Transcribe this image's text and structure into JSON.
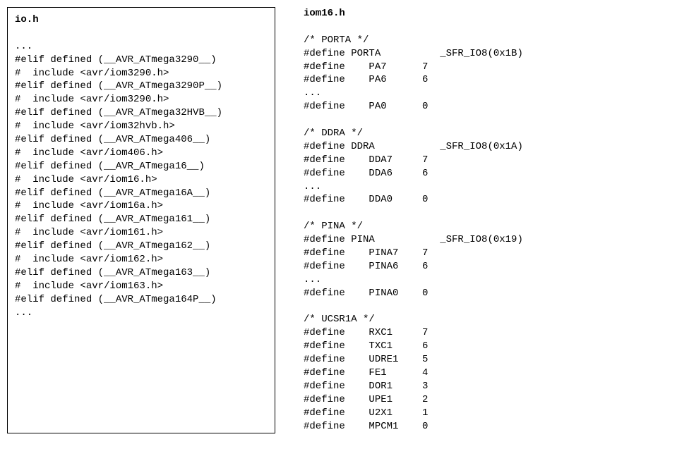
{
  "left": {
    "title": "io.h",
    "lines": [
      "...",
      "#elif defined (__AVR_ATmega3290__)",
      "#  include <avr/iom3290.h>",
      "#elif defined (__AVR_ATmega3290P__)",
      "#  include <avr/iom3290.h>",
      "#elif defined (__AVR_ATmega32HVB__)",
      "#  include <avr/iom32hvb.h>",
      "#elif defined (__AVR_ATmega406__)",
      "#  include <avr/iom406.h>",
      "#elif defined (__AVR_ATmega16__)",
      "#  include <avr/iom16.h>",
      "#elif defined (__AVR_ATmega16A__)",
      "#  include <avr/iom16a.h>",
      "#elif defined (__AVR_ATmega161__)",
      "#  include <avr/iom161.h>",
      "#elif defined (__AVR_ATmega162__)",
      "#  include <avr/iom162.h>",
      "#elif defined (__AVR_ATmega163__)",
      "#  include <avr/iom163.h>",
      "#elif defined (__AVR_ATmega164P__)",
      "..."
    ]
  },
  "right": {
    "title": "iom16.h",
    "sections": [
      {
        "comment": "/* PORTA */",
        "rows": [
          [
            "#define",
            "PORTA",
            "_SFR_IO8(0x1B)"
          ],
          [
            "#define",
            "PA7",
            "7"
          ],
          [
            "#define",
            "PA6",
            "6"
          ],
          [
            "...",
            "",
            ""
          ],
          [
            "#define",
            "PA0",
            "0"
          ]
        ]
      },
      {
        "comment": "/* DDRA */",
        "rows": [
          [
            "#define",
            "DDRA",
            "_SFR_IO8(0x1A)"
          ],
          [
            "#define",
            "DDA7",
            "7"
          ],
          [
            "#define",
            "DDA6",
            "6"
          ],
          [
            "...",
            "",
            ""
          ],
          [
            "#define",
            "DDA0",
            "0"
          ]
        ]
      },
      {
        "comment": "/* PINA */",
        "rows": [
          [
            "#define",
            "PINA",
            "_SFR_IO8(0x19)"
          ],
          [
            "#define",
            "PINA7",
            "7"
          ],
          [
            "#define",
            "PINA6",
            "6"
          ],
          [
            "...",
            "",
            ""
          ],
          [
            "#define",
            "PINA0",
            "0"
          ]
        ]
      },
      {
        "comment": "/* UCSR1A */",
        "rows": [
          [
            "#define",
            "RXC1",
            "7"
          ],
          [
            "#define",
            "TXC1",
            "6"
          ],
          [
            "#define",
            "UDRE1",
            "5"
          ],
          [
            "#define",
            "FE1",
            "4"
          ],
          [
            "#define",
            "DOR1",
            "3"
          ],
          [
            "#define",
            "UPE1",
            "2"
          ],
          [
            "#define",
            "U2X1",
            "1"
          ],
          [
            "#define",
            "MPCM1",
            "0"
          ]
        ]
      }
    ]
  }
}
